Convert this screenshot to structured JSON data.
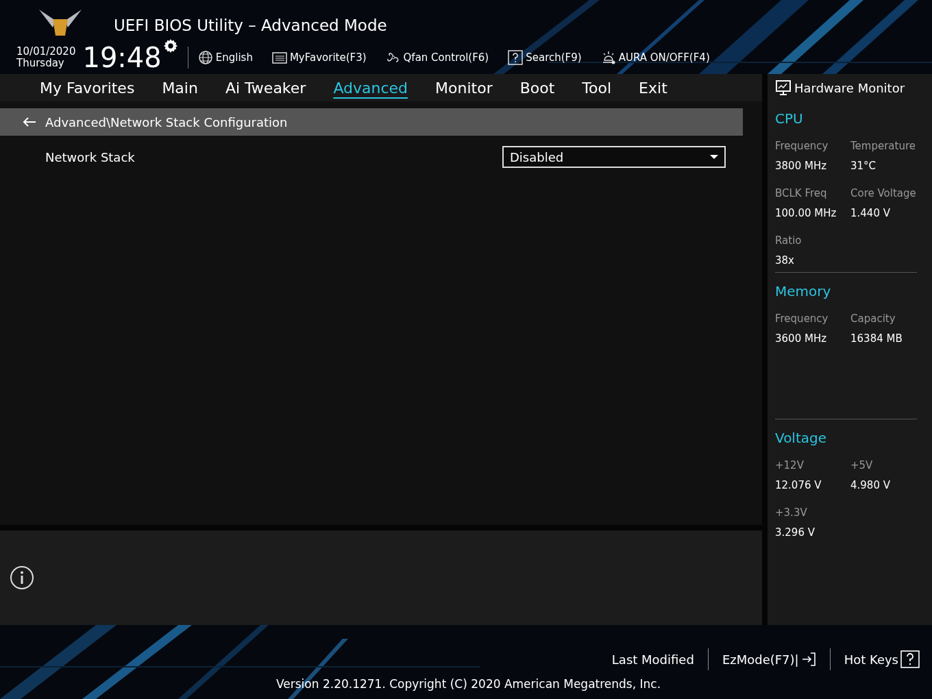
{
  "header": {
    "title": "UEFI BIOS Utility – Advanced Mode",
    "date": "10/01/2020",
    "day": "Thursday",
    "time": "19:48",
    "tools": [
      {
        "kind": "globe",
        "label": "English"
      },
      {
        "kind": "list",
        "label": "MyFavorite(F3)"
      },
      {
        "kind": "fan",
        "label": "Qfan Control(F6)"
      },
      {
        "kind": "help",
        "label": "Search(F9)"
      },
      {
        "kind": "lamp",
        "label": "AURA ON/OFF(F4)"
      }
    ]
  },
  "tabs": [
    {
      "label": "My Favorites",
      "selected": false
    },
    {
      "label": "Main",
      "selected": false
    },
    {
      "label": "Ai Tweaker",
      "selected": false
    },
    {
      "label": "Advanced",
      "selected": true
    },
    {
      "label": "Monitor",
      "selected": false
    },
    {
      "label": "Boot",
      "selected": false
    },
    {
      "label": "Tool",
      "selected": false
    },
    {
      "label": "Exit",
      "selected": false
    }
  ],
  "breadcrumb": "Advanced\\Network Stack Configuration",
  "settings": [
    {
      "label": "Network Stack",
      "value": "Disabled"
    }
  ],
  "hardware_monitor": {
    "title": "Hardware Monitor",
    "sections": [
      {
        "title": "CPU",
        "items": [
          {
            "label": "Frequency",
            "value": "3800 MHz"
          },
          {
            "label": "Temperature",
            "value": "31°C"
          },
          {
            "label": "BCLK Freq",
            "value": "100.00 MHz"
          },
          {
            "label": "Core Voltage",
            "value": "1.440 V"
          },
          {
            "label": "Ratio",
            "value": "38x"
          }
        ]
      },
      {
        "title": "Memory",
        "items": [
          {
            "label": "Frequency",
            "value": "3600 MHz"
          },
          {
            "label": "Capacity",
            "value": "16384 MB"
          }
        ]
      },
      {
        "title": "Voltage",
        "items": [
          {
            "label": "+12V",
            "value": "12.076 V"
          },
          {
            "label": "+5V",
            "value": "4.980 V"
          },
          {
            "label": "+3.3V",
            "value": "3.296 V"
          }
        ]
      }
    ]
  },
  "footer": {
    "buttons": [
      {
        "kind": "plain",
        "label": "Last Modified"
      },
      {
        "kind": "exit",
        "label": "EzMode(F7)|"
      },
      {
        "kind": "help",
        "label": "Hot Keys"
      }
    ],
    "version": "Version 2.20.1271. Copyright (C) 2020 American Megatrends, Inc."
  }
}
